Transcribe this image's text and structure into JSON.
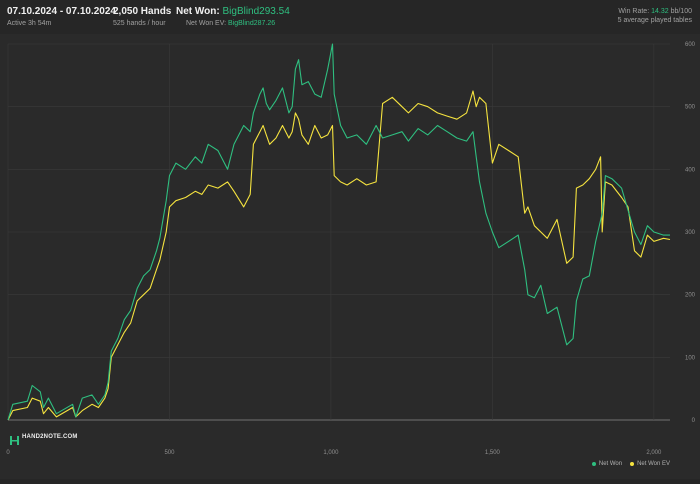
{
  "header": {
    "date_range": "07.10.2024 - 07.10.2024",
    "active": "Active 3h 54m",
    "hands": "2,050 Hands",
    "hands_rate": "525 hands / hour",
    "net_won_label": "Net Won:",
    "net_won_value": "BigBlind293.54",
    "net_won_ev_label": "Net Won EV:",
    "net_won_ev_value": "BigBlind287.26",
    "win_rate_label": "Win Rate:",
    "win_rate_value": "14.32",
    "win_rate_unit": "bb/100",
    "tables": "5 average played tables"
  },
  "logo_text": "HAND2NOTE.COM",
  "colors": {
    "net_won": "#2fbf80",
    "net_won_ev": "#f5e33f",
    "grid": "#3a3a3a",
    "background": "#2a2a2a"
  },
  "chart_data": {
    "type": "line",
    "xlim": [
      0,
      2050
    ],
    "ylim": [
      0,
      600
    ],
    "x_ticks": [
      {
        "value": 0,
        "label": "0"
      },
      {
        "value": 500,
        "label": "500"
      },
      {
        "value": 1000,
        "label": "1,000"
      },
      {
        "value": 1500,
        "label": "1,500"
      },
      {
        "value": 2000,
        "label": "2,000"
      }
    ],
    "y_ticks": [
      {
        "value": 0,
        "label": "0"
      },
      {
        "value": 100,
        "label": "100"
      },
      {
        "value": 200,
        "label": "200"
      },
      {
        "value": 300,
        "label": "300"
      },
      {
        "value": 400,
        "label": "400"
      },
      {
        "value": 500,
        "label": "500"
      },
      {
        "value": 600,
        "label": "600"
      }
    ],
    "series": [
      {
        "name": "Net Won",
        "color": "#2fbf80",
        "points": [
          [
            0,
            0
          ],
          [
            15,
            25
          ],
          [
            60,
            30
          ],
          [
            75,
            55
          ],
          [
            100,
            45
          ],
          [
            110,
            20
          ],
          [
            125,
            35
          ],
          [
            150,
            10
          ],
          [
            200,
            25
          ],
          [
            210,
            5
          ],
          [
            230,
            35
          ],
          [
            260,
            40
          ],
          [
            280,
            25
          ],
          [
            300,
            40
          ],
          [
            310,
            60
          ],
          [
            320,
            110
          ],
          [
            340,
            130
          ],
          [
            360,
            160
          ],
          [
            380,
            175
          ],
          [
            400,
            210
          ],
          [
            420,
            230
          ],
          [
            440,
            240
          ],
          [
            460,
            270
          ],
          [
            470,
            290
          ],
          [
            490,
            350
          ],
          [
            500,
            390
          ],
          [
            520,
            410
          ],
          [
            550,
            400
          ],
          [
            580,
            420
          ],
          [
            600,
            410
          ],
          [
            620,
            440
          ],
          [
            650,
            430
          ],
          [
            680,
            400
          ],
          [
            700,
            440
          ],
          [
            730,
            470
          ],
          [
            750,
            460
          ],
          [
            760,
            490
          ],
          [
            780,
            520
          ],
          [
            790,
            530
          ],
          [
            800,
            505
          ],
          [
            810,
            495
          ],
          [
            830,
            510
          ],
          [
            850,
            530
          ],
          [
            870,
            490
          ],
          [
            880,
            500
          ],
          [
            890,
            560
          ],
          [
            900,
            575
          ],
          [
            910,
            535
          ],
          [
            930,
            540
          ],
          [
            950,
            520
          ],
          [
            970,
            515
          ],
          [
            990,
            560
          ],
          [
            1005,
            600
          ],
          [
            1010,
            520
          ],
          [
            1030,
            470
          ],
          [
            1050,
            450
          ],
          [
            1080,
            455
          ],
          [
            1110,
            440
          ],
          [
            1140,
            470
          ],
          [
            1160,
            450
          ],
          [
            1190,
            455
          ],
          [
            1220,
            460
          ],
          [
            1240,
            445
          ],
          [
            1270,
            465
          ],
          [
            1300,
            455
          ],
          [
            1330,
            470
          ],
          [
            1360,
            460
          ],
          [
            1390,
            450
          ],
          [
            1420,
            445
          ],
          [
            1440,
            460
          ],
          [
            1450,
            420
          ],
          [
            1460,
            380
          ],
          [
            1480,
            330
          ],
          [
            1500,
            300
          ],
          [
            1520,
            275
          ],
          [
            1550,
            285
          ],
          [
            1580,
            295
          ],
          [
            1600,
            240
          ],
          [
            1610,
            200
          ],
          [
            1630,
            195
          ],
          [
            1650,
            215
          ],
          [
            1670,
            170
          ],
          [
            1700,
            180
          ],
          [
            1730,
            120
          ],
          [
            1750,
            130
          ],
          [
            1760,
            190
          ],
          [
            1780,
            225
          ],
          [
            1800,
            230
          ],
          [
            1820,
            285
          ],
          [
            1840,
            330
          ],
          [
            1850,
            390
          ],
          [
            1870,
            385
          ],
          [
            1900,
            370
          ],
          [
            1920,
            335
          ],
          [
            1940,
            300
          ],
          [
            1960,
            280
          ],
          [
            1980,
            310
          ],
          [
            2000,
            300
          ],
          [
            2030,
            295
          ],
          [
            2050,
            295
          ]
        ]
      },
      {
        "name": "Net Won  EV",
        "color": "#f5e33f",
        "points": [
          [
            0,
            0
          ],
          [
            15,
            15
          ],
          [
            60,
            20
          ],
          [
            75,
            35
          ],
          [
            100,
            30
          ],
          [
            110,
            10
          ],
          [
            125,
            20
          ],
          [
            150,
            5
          ],
          [
            200,
            20
          ],
          [
            210,
            5
          ],
          [
            230,
            15
          ],
          [
            260,
            25
          ],
          [
            280,
            20
          ],
          [
            300,
            35
          ],
          [
            310,
            50
          ],
          [
            320,
            100
          ],
          [
            340,
            120
          ],
          [
            360,
            140
          ],
          [
            380,
            155
          ],
          [
            400,
            190
          ],
          [
            420,
            200
          ],
          [
            440,
            210
          ],
          [
            460,
            240
          ],
          [
            470,
            255
          ],
          [
            490,
            300
          ],
          [
            500,
            340
          ],
          [
            520,
            350
          ],
          [
            550,
            355
          ],
          [
            580,
            365
          ],
          [
            600,
            360
          ],
          [
            620,
            375
          ],
          [
            650,
            370
          ],
          [
            680,
            380
          ],
          [
            700,
            365
          ],
          [
            730,
            340
          ],
          [
            750,
            360
          ],
          [
            760,
            440
          ],
          [
            780,
            460
          ],
          [
            790,
            470
          ],
          [
            800,
            455
          ],
          [
            810,
            440
          ],
          [
            830,
            450
          ],
          [
            850,
            470
          ],
          [
            870,
            450
          ],
          [
            880,
            460
          ],
          [
            890,
            490
          ],
          [
            900,
            480
          ],
          [
            910,
            455
          ],
          [
            930,
            440
          ],
          [
            950,
            470
          ],
          [
            970,
            450
          ],
          [
            990,
            455
          ],
          [
            1005,
            470
          ],
          [
            1010,
            390
          ],
          [
            1030,
            380
          ],
          [
            1050,
            375
          ],
          [
            1080,
            385
          ],
          [
            1110,
            375
          ],
          [
            1140,
            380
          ],
          [
            1160,
            505
          ],
          [
            1190,
            515
          ],
          [
            1220,
            500
          ],
          [
            1240,
            490
          ],
          [
            1270,
            505
          ],
          [
            1300,
            500
          ],
          [
            1330,
            490
          ],
          [
            1360,
            485
          ],
          [
            1390,
            480
          ],
          [
            1420,
            490
          ],
          [
            1440,
            525
          ],
          [
            1450,
            500
          ],
          [
            1460,
            515
          ],
          [
            1480,
            505
          ],
          [
            1500,
            410
          ],
          [
            1520,
            440
          ],
          [
            1550,
            430
          ],
          [
            1580,
            420
          ],
          [
            1600,
            330
          ],
          [
            1610,
            340
          ],
          [
            1630,
            310
          ],
          [
            1650,
            300
          ],
          [
            1670,
            290
          ],
          [
            1700,
            320
          ],
          [
            1730,
            250
          ],
          [
            1750,
            260
          ],
          [
            1760,
            370
          ],
          [
            1780,
            375
          ],
          [
            1800,
            385
          ],
          [
            1820,
            400
          ],
          [
            1835,
            420
          ],
          [
            1840,
            300
          ],
          [
            1850,
            380
          ],
          [
            1870,
            375
          ],
          [
            1900,
            355
          ],
          [
            1920,
            340
          ],
          [
            1940,
            270
          ],
          [
            1960,
            260
          ],
          [
            1980,
            295
          ],
          [
            2000,
            285
          ],
          [
            2030,
            290
          ],
          [
            2050,
            288
          ]
        ]
      }
    ]
  }
}
